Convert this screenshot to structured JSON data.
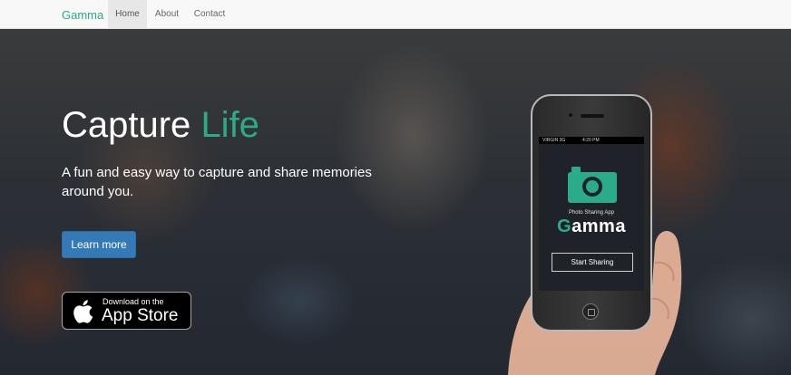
{
  "navbar": {
    "brand": "Gamma",
    "items": [
      {
        "label": "Home",
        "active": true
      },
      {
        "label": "About",
        "active": false
      },
      {
        "label": "Contact",
        "active": false
      }
    ]
  },
  "hero": {
    "title_main": "Capture",
    "title_accent": "Life",
    "subtitle": "A fun and easy way to capture and share memories around you.",
    "cta_label": "Learn more",
    "appstore": {
      "small_text": "Download on the",
      "big_text": "App Store",
      "icon": "apple-icon"
    }
  },
  "phone_screen": {
    "carrier": "VIRGIN",
    "network": "3G",
    "time": "4:20 PM",
    "icon": "camera-icon",
    "caption": "Photo Sharing App",
    "app_name_first": "G",
    "app_name_rest": "amma",
    "button_label": "Start Sharing"
  },
  "colors": {
    "accent": "#2bab88",
    "primary_button": "#337ab7",
    "navbar_bg": "#f8f8f8"
  }
}
